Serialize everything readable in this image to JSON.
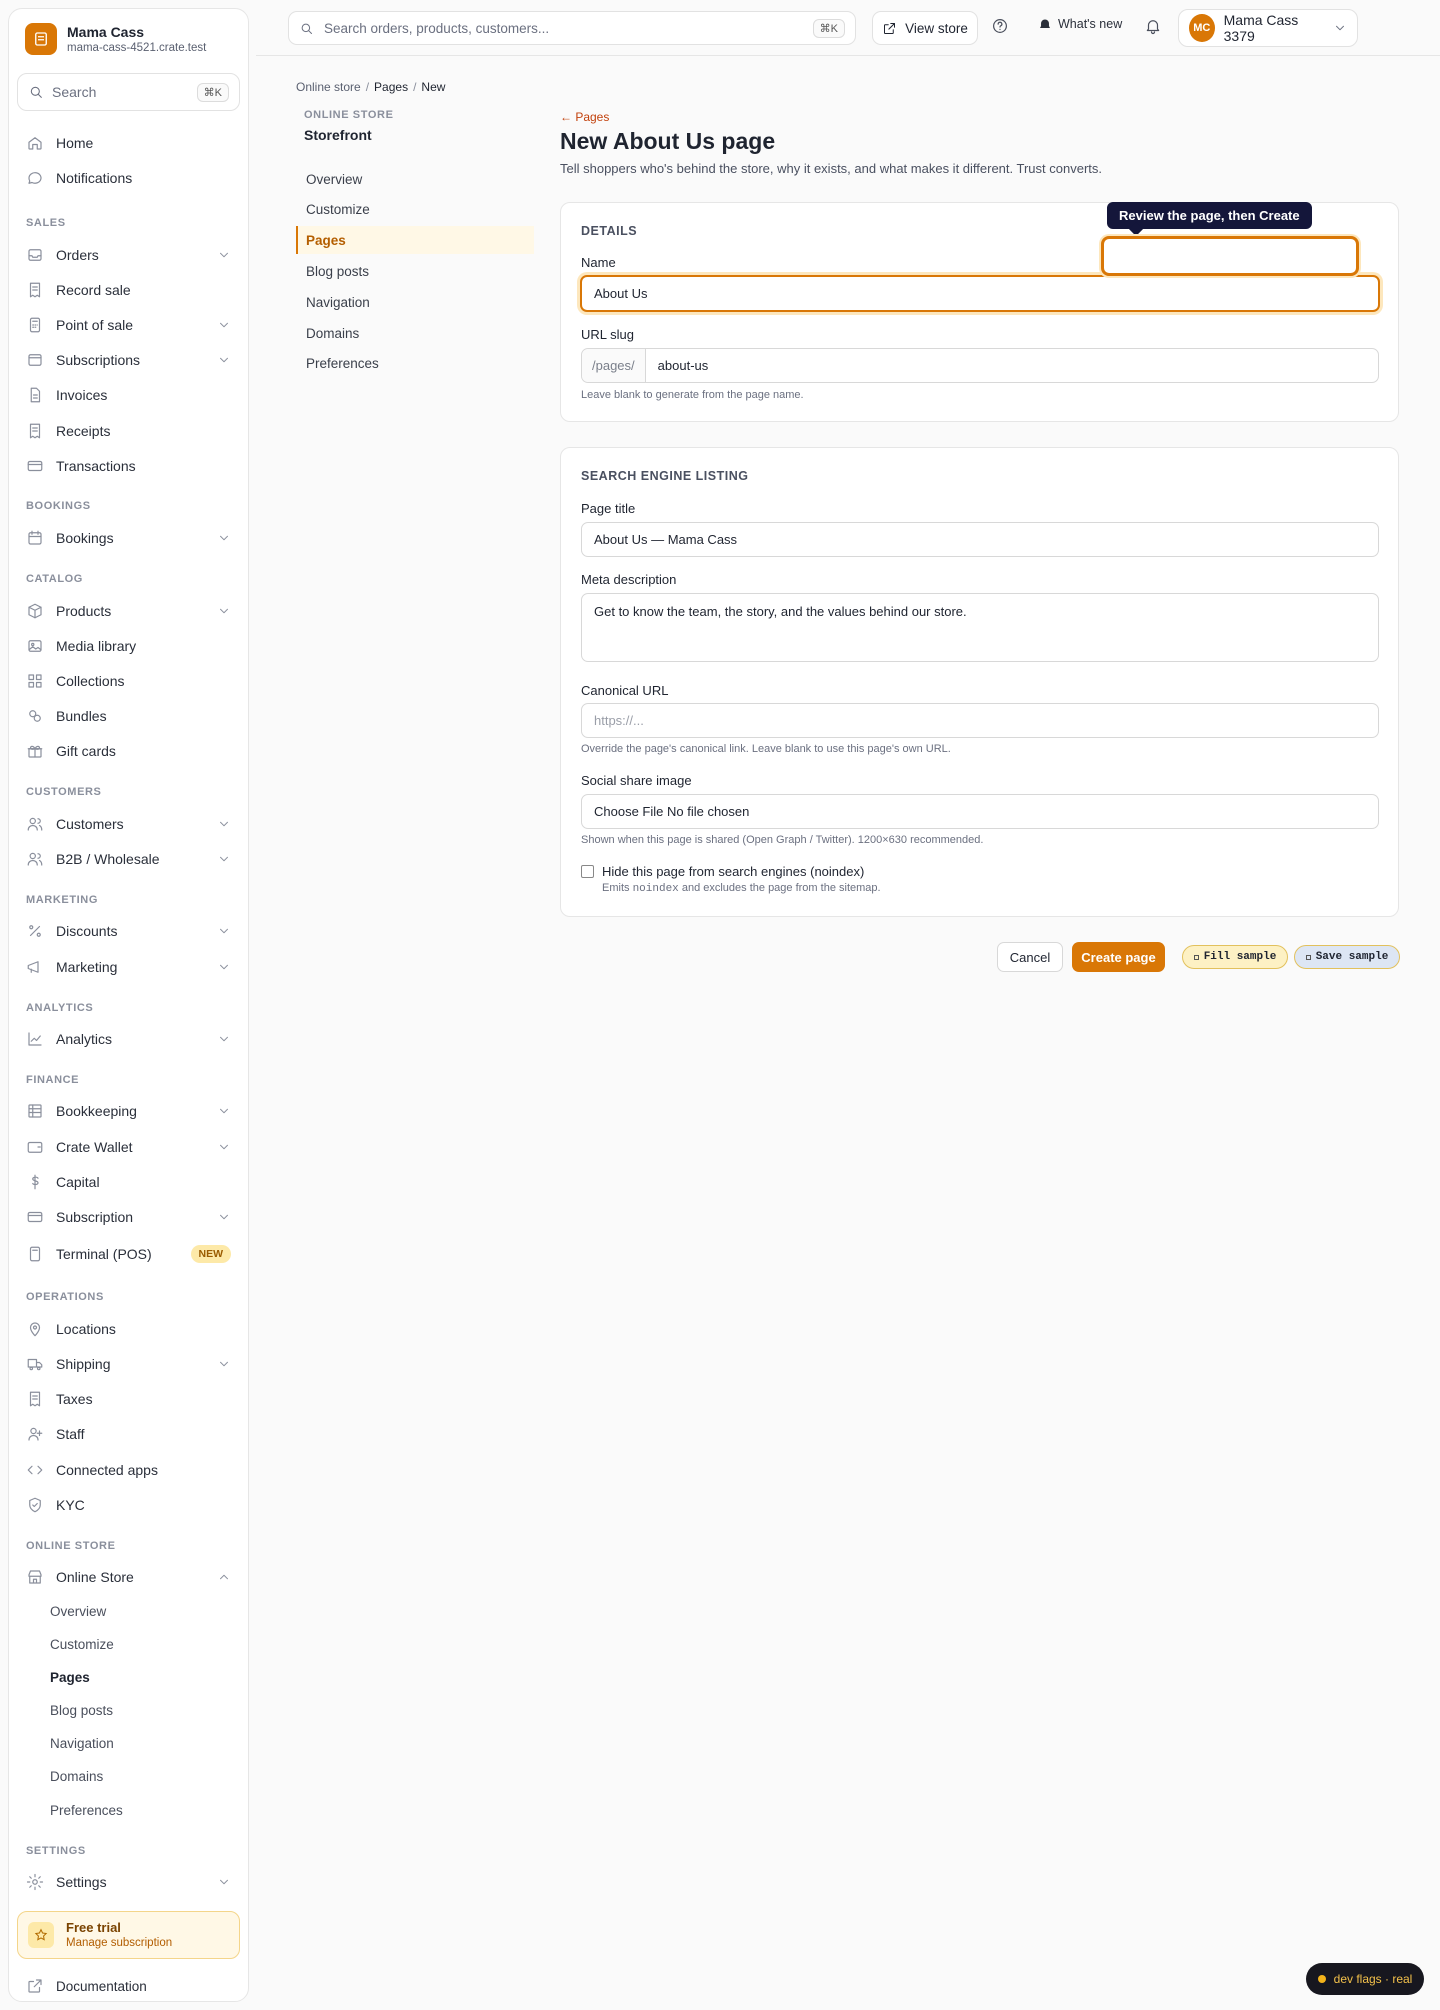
{
  "brand": {
    "name": "Mama Cass",
    "domain": "mama-cass-4521.crate.test"
  },
  "sidebar_search": {
    "placeholder": "Search",
    "shortcut": "⌘K"
  },
  "nav": {
    "home": "Home",
    "notifications": "Notifications",
    "sec_sales": "SALES",
    "orders": "Orders",
    "record_sale": "Record sale",
    "point_of_sale": "Point of sale",
    "subscriptions": "Subscriptions",
    "invoices": "Invoices",
    "receipts": "Receipts",
    "transactions": "Transactions",
    "sec_bookings": "BOOKINGS",
    "bookings": "Bookings",
    "sec_catalog": "CATALOG",
    "products": "Products",
    "media_library": "Media library",
    "collections": "Collections",
    "bundles": "Bundles",
    "gift_cards": "Gift cards",
    "sec_customers": "CUSTOMERS",
    "customers": "Customers",
    "b2b": "B2B / Wholesale",
    "sec_marketing": "MARKETING",
    "discounts": "Discounts",
    "marketing": "Marketing",
    "sec_analytics": "ANALYTICS",
    "analytics": "Analytics",
    "sec_finance": "FINANCE",
    "bookkeeping": "Bookkeeping",
    "crate_wallet": "Crate Wallet",
    "capital": "Capital",
    "subscription": "Subscription",
    "terminal": "Terminal (POS)",
    "terminal_badge": "NEW",
    "sec_operations": "OPERATIONS",
    "locations": "Locations",
    "shipping": "Shipping",
    "taxes": "Taxes",
    "staff": "Staff",
    "connected_apps": "Connected apps",
    "kyc": "KYC",
    "sec_online_store": "ONLINE STORE",
    "online_store": "Online Store",
    "os_sub": [
      "Overview",
      "Customize",
      "Pages",
      "Blog posts",
      "Navigation",
      "Domains",
      "Preferences"
    ],
    "sec_settings": "SETTINGS",
    "settings": "Settings"
  },
  "trial": {
    "title": "Free trial",
    "subtitle": "Manage subscription"
  },
  "documentation": "Documentation",
  "topbar": {
    "search_placeholder": "Search orders, products, customers...",
    "search_shortcut": "⌘K",
    "view_store": "View store",
    "whats_new": "What's new",
    "account_initials": "MC",
    "account_name": "Mama Cass 3379"
  },
  "breadcrumb": {
    "root": "Online store",
    "parent": "Pages",
    "current": "New",
    "sep": "/"
  },
  "subnav": {
    "label": "ONLINE STORE",
    "title": "Storefront",
    "items": [
      "Overview",
      "Customize",
      "Pages",
      "Blog posts",
      "Navigation",
      "Domains",
      "Preferences"
    ]
  },
  "page": {
    "back": "← Pages",
    "title": "New About Us page",
    "description": "Tell shoppers who's behind the store, why it exists, and what makes it different. Trust converts."
  },
  "details": {
    "title": "DETAILS",
    "name_label": "Name",
    "name_value": "About Us",
    "slug_label": "URL slug",
    "slug_prefix": "/pages/",
    "slug_value": "about-us",
    "slug_help": "Leave blank to generate from the page name."
  },
  "seo": {
    "title": "SEARCH ENGINE LISTING",
    "page_title_label": "Page title",
    "page_title_value": "About Us — Mama Cass",
    "meta_label": "Meta description",
    "meta_value": "Get to know the team, the story, and the values behind our store.",
    "canonical_label": "Canonical URL",
    "canonical_placeholder": "https://...",
    "canonical_help": "Override the page's canonical link. Leave blank to use this page's own URL.",
    "share_label": "Social share image",
    "share_value": "Choose File No file chosen",
    "share_help": "Shown when this page is shared (Open Graph / Twitter). 1200×630 recommended.",
    "noindex_label": "Hide this page from search engines (noindex)",
    "noindex_help_pre": "Emits ",
    "noindex_help_code": "noindex",
    "noindex_help_post": " and excludes the page from the sitemap.",
    "noindex_checked": false
  },
  "tooltip": "Review the page, then Create",
  "actions": {
    "cancel": "Cancel",
    "create": "Create page",
    "fill_sample": "Fill sample",
    "save_sample": "Save sample"
  },
  "dev_flags": "dev flags · real",
  "colors": {
    "accent": "#d97706",
    "tooltip_bg": "#14163a"
  }
}
